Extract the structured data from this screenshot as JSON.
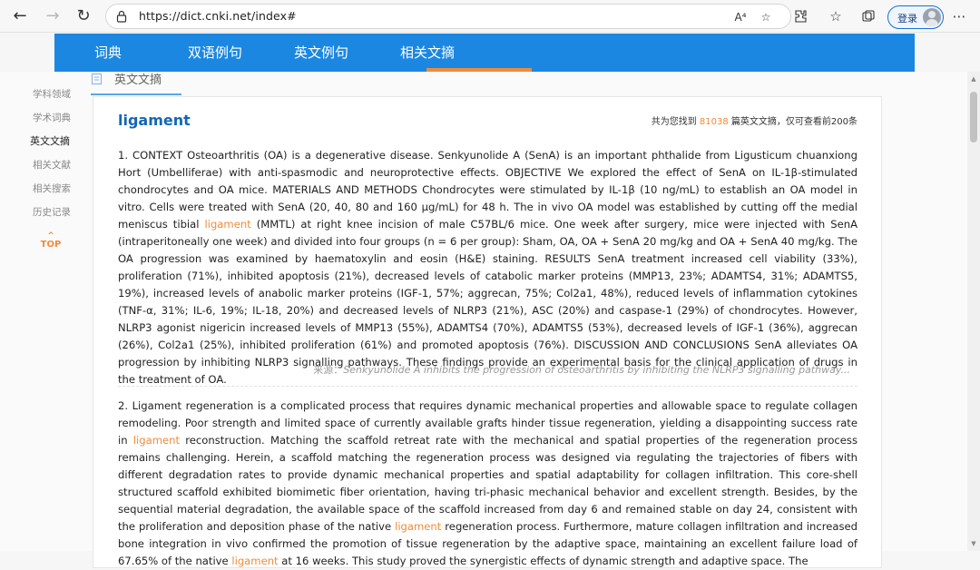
{
  "browser": {
    "url": "https://dict.cnki.net/index#",
    "login_label": "登录"
  },
  "nav": {
    "tabs": [
      {
        "label": "词典"
      },
      {
        "label": "双语例句"
      },
      {
        "label": "英文例句"
      },
      {
        "label": "相关文摘",
        "active": true
      }
    ]
  },
  "section": {
    "title": "英文文摘"
  },
  "sidebar": {
    "items": [
      {
        "label": "学科领域"
      },
      {
        "label": "学术词典"
      },
      {
        "label": "英文文摘",
        "active": true
      },
      {
        "label": "相关文献"
      },
      {
        "label": "相关搜索"
      },
      {
        "label": "历史记录"
      }
    ],
    "top_label": "TOP"
  },
  "result": {
    "keyword": "ligament",
    "count_prefix": "共为您找到",
    "count_value": "81038",
    "count_suffix": "篇英文文摘，仅可查看前200条"
  },
  "abstracts": [
    {
      "parts": [
        "1. CONTEXT Osteoarthritis (OA) is a degenerative disease. Senkyunolide A (SenA) is an important phthalide from Ligusticum chuanxiong Hort (Umbelliferae) with anti-spasmodic and neuroprotective effects. OBJECTIVE We explored the effect of SenA on IL-1β-stimulated chondrocytes and OA mice. MATERIALS AND METHODS Chondrocytes were stimulated by IL-1β (10 ng/mL) to establish an OA model in vitro. Cells were treated with SenA (20, 40, 80 and 160 μg/mL) for 48 h. The in vivo OA model was established by cutting off the medial meniscus tibial ",
        "ligament",
        " (MMTL) at right knee incision of male C57BL/6 mice. One week after surgery, mice were injected with SenA (intraperitoneally one week) and divided into four groups (n = 6 per group): Sham, OA, OA + SenA 20 mg/kg and OA + SenA 40 mg/kg. The OA progression was examined by haematoxylin and eosin (H&E) staining. RESULTS SenA treatment increased cell viability (33%), proliferation (71%), inhibited apoptosis (21%), decreased levels of catabolic marker proteins (MMP13, 23%; ADAMTS4, 31%; ADAMTS5, 19%), increased levels of anabolic marker proteins (IGF-1, 57%; aggrecan, 75%; Col2a1, 48%), reduced levels of inflammation cytokines (TNF-α, 31%; IL-6, 19%; IL-18, 20%) and decreased levels of NLRP3 (21%), ASC (20%) and caspase-1 (29%) of chondrocytes. However, NLRP3 agonist nigericin increased levels of MMP13 (55%), ADAMTS4 (70%), ADAMTS5 (53%), decreased levels of IGF-1 (36%), aggrecan (26%), Col2a1 (25%), inhibited proliferation (61%) and promoted apoptosis (76%). DISCUSSION AND CONCLUSIONS SenA alleviates OA progression by inhibiting NLRP3 signalling pathways. These findings provide an experimental basis for the clinical application of drugs in the treatment of OA."
      ],
      "source_label": "来源：",
      "source_title": "Senkyunolide A inhibits the progression of osteoarthritis by inhibiting the NLRP3 signalling pathway..."
    },
    {
      "parts": [
        "2. Ligament regeneration is a complicated process that requires dynamic mechanical properties and allowable space to regulate collagen remodeling. Poor strength and limited space of currently available grafts hinder tissue regeneration, yielding a disappointing success rate in ",
        "ligament",
        " reconstruction. Matching the scaffold retreat rate with the mechanical and spatial properties of the regeneration process remains challenging. Herein, a scaffold matching the regeneration process was designed via regulating the trajectories of fibers with different degradation rates to provide dynamic mechanical properties and spatial adaptability for collagen infiltration. This core-shell structured scaffold exhibited biomimetic fiber orientation, having tri-phasic mechanical behavior and excellent strength. Besides, by the sequential material degradation, the available space of the scaffold increased from day 6 and remained stable on day 24, consistent with the proliferation and deposition phase of the native ",
        "ligament",
        " regeneration process. Furthermore, mature collagen infiltration and increased bone integration in vivo confirmed the promotion of tissue regeneration by the adaptive space, maintaining an excellent failure load of 67.65% of the native ",
        "ligament",
        " at 16 weeks. This study proved the synergistic effects of dynamic strength and adaptive space. The"
      ]
    }
  ]
}
